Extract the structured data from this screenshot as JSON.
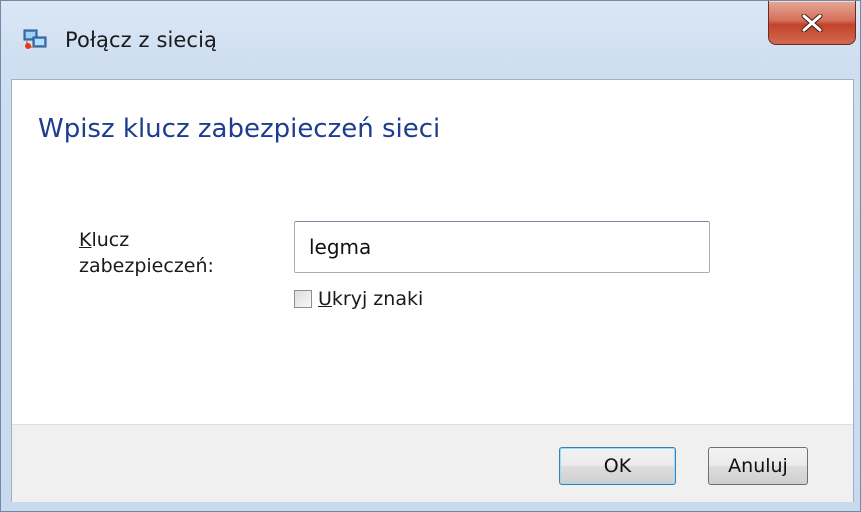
{
  "window": {
    "title": "Połącz z siecią",
    "icon": "network-icon",
    "close_icon": "close-icon"
  },
  "main": {
    "heading": "Wpisz klucz zabezpieczeń sieci",
    "key_label_accel": "K",
    "key_label_rest_line1": "lucz",
    "key_label_line2": "zabezpieczeń:",
    "key_value": "legma",
    "hide_chars_checked": false,
    "hide_chars_accel": "U",
    "hide_chars_rest": "kryj znaki"
  },
  "footer": {
    "ok_label": "OK",
    "cancel_label": "Anuluj"
  },
  "colors": {
    "heading": "#1e3d8f",
    "close_button": "#c2432b"
  }
}
